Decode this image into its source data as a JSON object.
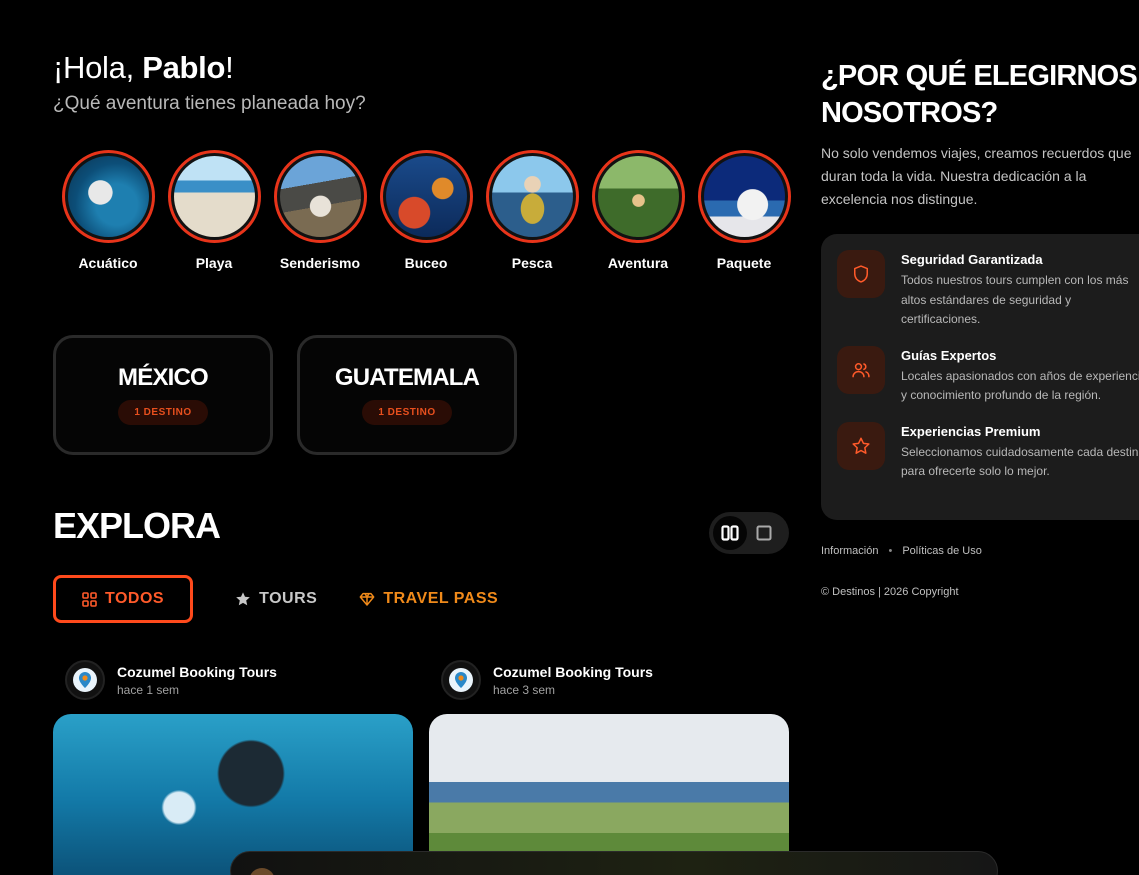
{
  "greeting": {
    "prefix": "¡Hola, ",
    "name": "Pablo",
    "suffix": "!"
  },
  "subtitle": "¿Qué aventura tienes planeada hoy?",
  "categories": [
    {
      "label": "Acuático"
    },
    {
      "label": "Playa"
    },
    {
      "label": "Senderismo"
    },
    {
      "label": "Buceo"
    },
    {
      "label": "Pesca"
    },
    {
      "label": "Aventura"
    },
    {
      "label": "Paquete"
    }
  ],
  "destinations": [
    {
      "name": "MÉXICO",
      "count": "1 DESTINO"
    },
    {
      "name": "GUATEMALA",
      "count": "1 DESTINO"
    }
  ],
  "explore": {
    "title": "EXPLORA",
    "tabs": {
      "all": "TODOS",
      "tours": "TOURS",
      "pass": "TRAVEL PASS"
    }
  },
  "posts": [
    {
      "author": "Cozumel Booking Tours",
      "time": "hace 1 sem"
    },
    {
      "author": "Cozumel Booking Tours",
      "time": "hace 3 sem"
    }
  ],
  "why": {
    "title_line1": "¿POR QUÉ ELEGIRNOS",
    "title_line2": "NOSOTROS?",
    "text": "No solo vendemos viajes, creamos recuerdos que duran toda la vida. Nuestra dedicación a la excelencia nos distingue.",
    "features": [
      {
        "title": "Seguridad Garantizada",
        "desc": "Todos nuestros tours cumplen con los más altos estándares de seguridad y certificaciones.",
        "icon": "shield-icon"
      },
      {
        "title": "Guías Expertos",
        "desc": "Locales apasionados con años de experiencia y conocimiento profundo de la región.",
        "icon": "users-icon"
      },
      {
        "title": "Experiencias Premium",
        "desc": "Seleccionamos cuidadosamente cada destino para ofrecerte solo lo mejor.",
        "icon": "star-icon"
      }
    ]
  },
  "footer": {
    "info": "Información",
    "sep": "•",
    "policies": "Políticas de Uso",
    "copyright": "© Destinos | 2026 Copyright"
  },
  "colors": {
    "accent": "#ff4a1c",
    "ring": "#e8341a",
    "pass": "#f08a1a"
  }
}
